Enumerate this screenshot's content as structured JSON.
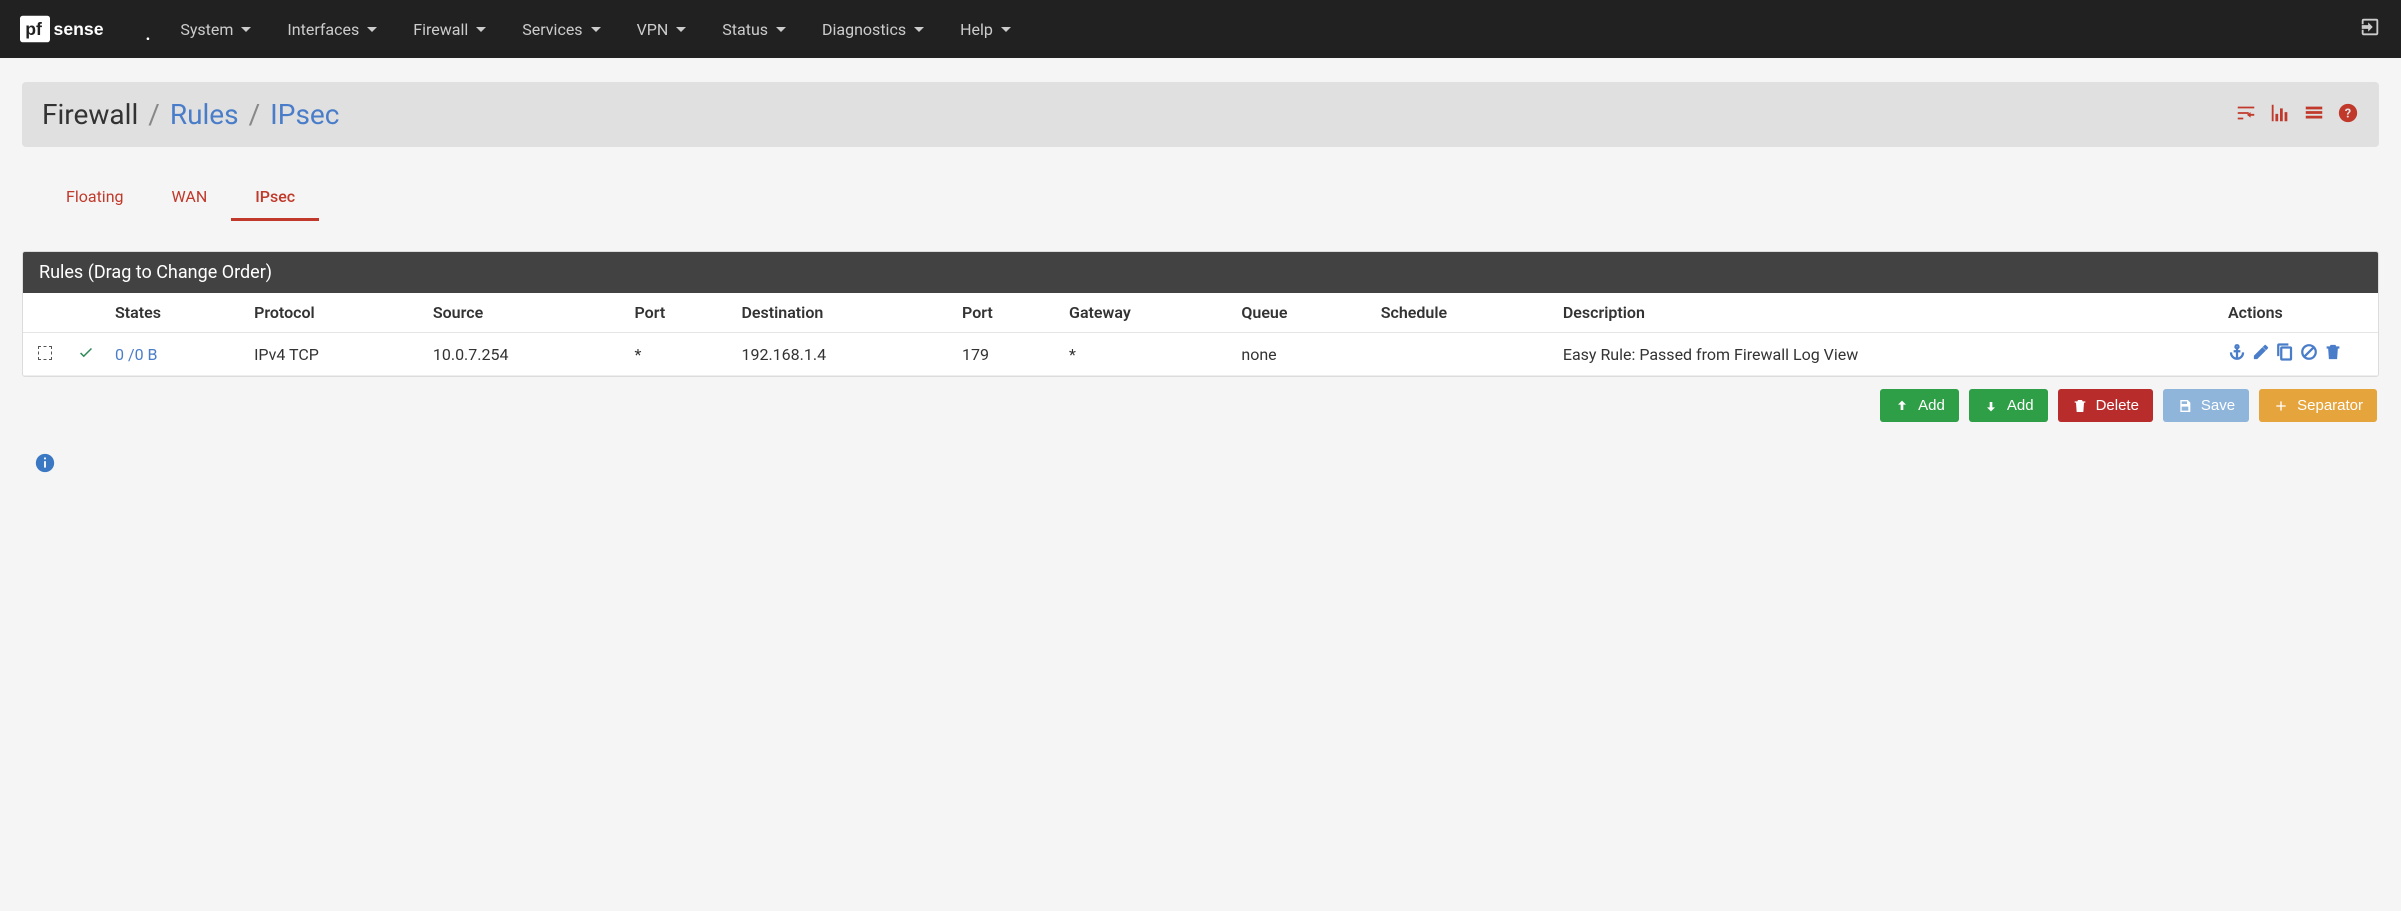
{
  "brand": {
    "left": "pf",
    "right": "sense"
  },
  "nav": {
    "items": [
      "System",
      "Interfaces",
      "Firewall",
      "Services",
      "VPN",
      "Status",
      "Diagnostics",
      "Help"
    ]
  },
  "breadcrumb": {
    "root": "Firewall",
    "mid": "Rules",
    "leaf": "IPsec"
  },
  "tabs": [
    {
      "label": "Floating",
      "active": false
    },
    {
      "label": "WAN",
      "active": false
    },
    {
      "label": "IPsec",
      "active": true
    }
  ],
  "panel": {
    "title": "Rules (Drag to Change Order)"
  },
  "columns": {
    "states": "States",
    "protocol": "Protocol",
    "source": "Source",
    "sport": "Port",
    "destination": "Destination",
    "dport": "Port",
    "gateway": "Gateway",
    "queue": "Queue",
    "schedule": "Schedule",
    "description": "Description",
    "actions": "Actions"
  },
  "rows": [
    {
      "states": "0 /0 B",
      "protocol": "IPv4 TCP",
      "source": "10.0.7.254",
      "sport": "*",
      "destination": "192.168.1.4",
      "dport": "179",
      "gateway": "*",
      "queue": "none",
      "schedule": "",
      "description": "Easy Rule: Passed from Firewall Log View"
    }
  ],
  "buttons": {
    "add_top": "Add",
    "add_bottom": "Add",
    "delete": "Delete",
    "save": "Save",
    "separator": "Separator"
  }
}
